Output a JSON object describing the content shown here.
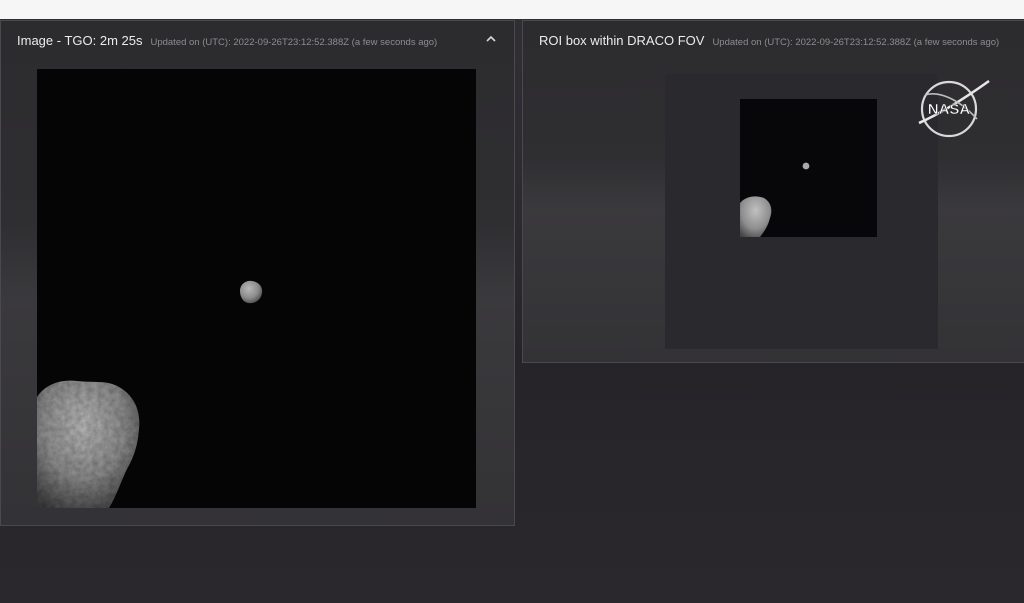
{
  "panels": [
    {
      "title": "Image - TGO: 2m 25s",
      "updated": "Updated on (UTC): 2022-09-26T23:12:52.388Z (a few seconds ago)",
      "collapse_icon": "chevron-up-icon"
    },
    {
      "title": "ROI box within DRACO FOV",
      "updated": "Updated on (UTC): 2022-09-26T23:12:52.388Z (a few seconds ago)"
    }
  ],
  "logo": {
    "name": "nasa-logo",
    "text": "NASA",
    "colors": {
      "ring": "#d9d9d9",
      "text": "#ffffff"
    }
  },
  "colors": {
    "background": "#2a282d",
    "panel": "#2e2d30",
    "image_bg": "#050505",
    "roi_box": "#2a292d",
    "asteroid": "#8a8a8a"
  }
}
